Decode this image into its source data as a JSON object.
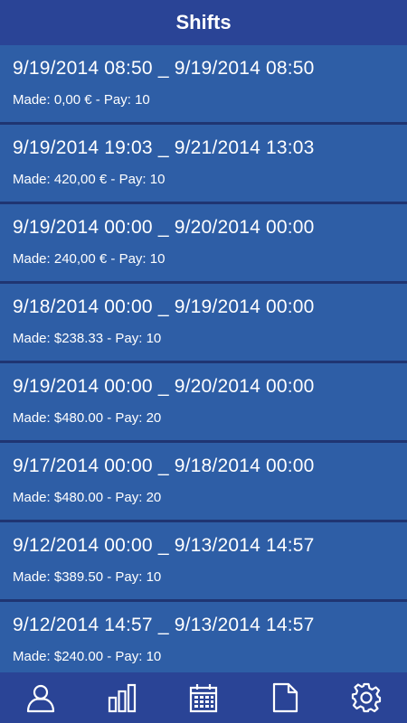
{
  "header": {
    "title": "Shifts"
  },
  "shifts": [
    {
      "range": "9/19/2014 08:50 _ 9/19/2014 08:50",
      "made": "Made: 0,00 € - Pay: 10"
    },
    {
      "range": "9/19/2014 19:03 _ 9/21/2014 13:03",
      "made": "Made: 420,00 € - Pay: 10"
    },
    {
      "range": "9/19/2014 00:00 _ 9/20/2014 00:00",
      "made": "Made: 240,00 € - Pay: 10"
    },
    {
      "range": "9/18/2014 00:00 _ 9/19/2014 00:00",
      "made": "Made: $238.33 - Pay: 10"
    },
    {
      "range": "9/19/2014 00:00 _ 9/20/2014 00:00",
      "made": "Made: $480.00 - Pay: 20"
    },
    {
      "range": "9/17/2014 00:00 _ 9/18/2014 00:00",
      "made": "Made: $480.00 - Pay: 20"
    },
    {
      "range": "9/12/2014 00:00 _ 9/13/2014 14:57",
      "made": "Made: $389.50 - Pay: 10"
    },
    {
      "range": "9/12/2014 14:57 _ 9/13/2014 14:57",
      "made": "Made: $240.00 - Pay: 10"
    }
  ],
  "tabbar": {
    "icons": [
      "user-icon",
      "bar-chart-icon",
      "calendar-icon",
      "document-icon",
      "gear-icon"
    ]
  },
  "colors": {
    "header_bg": "#2a4496",
    "item_bg": "#2e5ea6",
    "divider": "#1f3572",
    "text": "#ffffff"
  }
}
